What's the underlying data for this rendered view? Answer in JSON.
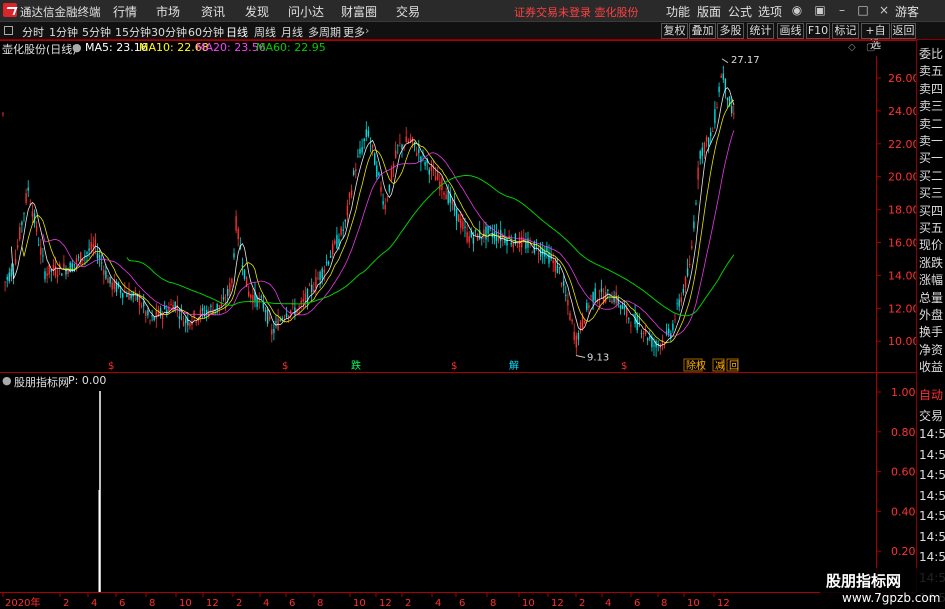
{
  "app_title": "通达信金融终端",
  "menu": [
    "行情",
    "市场",
    "资讯",
    "发现",
    "问小达",
    "财富圈",
    "交易"
  ],
  "title_alert": "证券交易未登录 壶化股份",
  "right_menu": [
    "功能",
    "版面",
    "公式",
    "选项"
  ],
  "guest": "游客",
  "periods": [
    "分时",
    "1分钟",
    "5分钟",
    "15分钟",
    "30分钟",
    "60分钟",
    "日线",
    "周线",
    "月线",
    "多周期",
    "更多"
  ],
  "active_period": "日线",
  "toolbar_buttons": [
    "复权",
    "叠加",
    "多股",
    "统计",
    "画线",
    "F10",
    "标记",
    "+自选",
    "返回"
  ],
  "stock_name": "壶化股份(日线)",
  "ma": {
    "ma5": "MA5: 23.16",
    "ma10": "MA10: 22.68",
    "ma20": "MA20: 23.56",
    "ma60": "MA60: 22.95"
  },
  "colors": {
    "ma5": "#ffffff",
    "ma10": "#ffff00",
    "ma20": "#ff40ff",
    "ma60": "#00cc00",
    "up": "#ff3030",
    "down": "#00e0e0",
    "border": "#aa0000"
  },
  "price_axis": [
    "26.00",
    "24.00",
    "22.00",
    "20.00",
    "18.00",
    "16.00",
    "14.00",
    "12.00",
    "10.00"
  ],
  "high_label": "27.17",
  "low_label": "9.13",
  "event_markers": [
    "$",
    "$",
    "跌",
    "$",
    "解",
    "$",
    "除权",
    "减",
    "回"
  ],
  "lower_indicator": "股朋指标网",
  "lower_value": "P: 0.00",
  "lower_axis": [
    "1.00",
    "0.80",
    "0.60",
    "0.40",
    "0.20"
  ],
  "right_panel": [
    "委比",
    "卖五",
    "卖四",
    "卖三",
    "卖二",
    "卖一",
    "买一",
    "买二",
    "买三",
    "买四",
    "买五",
    "现价",
    "涨跌",
    "涨幅",
    "总量",
    "外盘",
    "换手",
    "净资",
    "收益"
  ],
  "right_lower": [
    "自动",
    "交易",
    "14:56",
    "14:56",
    "14:56",
    "14:56",
    "14:56",
    "14:56",
    "14:56",
    "14:56",
    "14:56",
    "14:56"
  ],
  "x_axis": [
    "2020年",
    "2",
    "4",
    "6",
    "8",
    "10",
    "12",
    "2",
    "4",
    "6",
    "8",
    "10",
    "12",
    "2",
    "4",
    "6",
    "8",
    "10",
    "12",
    "2",
    "4",
    "6",
    "8",
    "10",
    "12"
  ],
  "watermark_big": "股朋指标网",
  "watermark_small": "www.7gpzb.com"
}
